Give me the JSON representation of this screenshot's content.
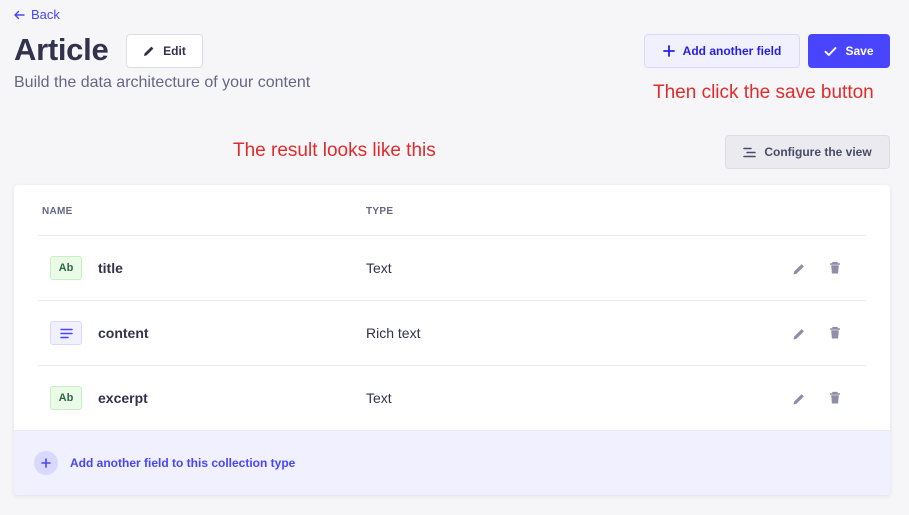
{
  "header": {
    "back_label": "Back",
    "title": "Article",
    "edit_label": "Edit",
    "subtitle": "Build the data architecture of your content",
    "add_field_label": "Add another field",
    "save_label": "Save"
  },
  "annotations": {
    "save_hint": "Then click the save button",
    "result_hint": "The result looks like this"
  },
  "toolbar": {
    "configure_label": "Configure the view"
  },
  "table": {
    "columns": [
      "NAME",
      "TYPE"
    ],
    "rows": [
      {
        "badge": "Ab",
        "badge_icon": "text-icon",
        "name": "title",
        "type": "Text"
      },
      {
        "badge": "",
        "badge_icon": "richtext-icon",
        "name": "content",
        "type": "Rich text"
      },
      {
        "badge": "Ab",
        "badge_icon": "text-icon",
        "name": "excerpt",
        "type": "Text"
      }
    ],
    "add_field_label": "Add another field to this collection type"
  },
  "colors": {
    "primary": "#4945ff",
    "annotation": "#e02b2b",
    "text_badge_bg": "#eafbe7",
    "richtext_badge_bg": "#f0f0ff"
  },
  "icons": {
    "back": "arrow-left-icon",
    "edit": "pencil-icon",
    "add": "plus-icon",
    "save": "check-icon",
    "configure": "list-settings-icon",
    "row_edit": "pencil-icon",
    "row_delete": "trash-icon"
  }
}
